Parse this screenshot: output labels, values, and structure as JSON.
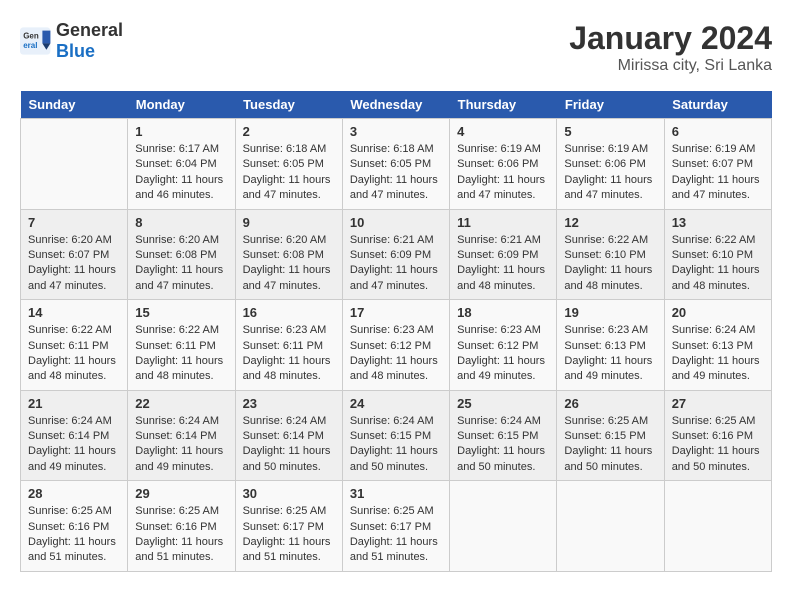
{
  "logo": {
    "general": "General",
    "blue": "Blue"
  },
  "title": "January 2024",
  "subtitle": "Mirissa city, Sri Lanka",
  "days_header": [
    "Sunday",
    "Monday",
    "Tuesday",
    "Wednesday",
    "Thursday",
    "Friday",
    "Saturday"
  ],
  "weeks": [
    [
      {
        "day": "",
        "info": ""
      },
      {
        "day": "1",
        "info": "Sunrise: 6:17 AM\nSunset: 6:04 PM\nDaylight: 11 hours\nand 46 minutes."
      },
      {
        "day": "2",
        "info": "Sunrise: 6:18 AM\nSunset: 6:05 PM\nDaylight: 11 hours\nand 47 minutes."
      },
      {
        "day": "3",
        "info": "Sunrise: 6:18 AM\nSunset: 6:05 PM\nDaylight: 11 hours\nand 47 minutes."
      },
      {
        "day": "4",
        "info": "Sunrise: 6:19 AM\nSunset: 6:06 PM\nDaylight: 11 hours\nand 47 minutes."
      },
      {
        "day": "5",
        "info": "Sunrise: 6:19 AM\nSunset: 6:06 PM\nDaylight: 11 hours\nand 47 minutes."
      },
      {
        "day": "6",
        "info": "Sunrise: 6:19 AM\nSunset: 6:07 PM\nDaylight: 11 hours\nand 47 minutes."
      }
    ],
    [
      {
        "day": "7",
        "info": "Sunrise: 6:20 AM\nSunset: 6:07 PM\nDaylight: 11 hours\nand 47 minutes."
      },
      {
        "day": "8",
        "info": "Sunrise: 6:20 AM\nSunset: 6:08 PM\nDaylight: 11 hours\nand 47 minutes."
      },
      {
        "day": "9",
        "info": "Sunrise: 6:20 AM\nSunset: 6:08 PM\nDaylight: 11 hours\nand 47 minutes."
      },
      {
        "day": "10",
        "info": "Sunrise: 6:21 AM\nSunset: 6:09 PM\nDaylight: 11 hours\nand 47 minutes."
      },
      {
        "day": "11",
        "info": "Sunrise: 6:21 AM\nSunset: 6:09 PM\nDaylight: 11 hours\nand 48 minutes."
      },
      {
        "day": "12",
        "info": "Sunrise: 6:22 AM\nSunset: 6:10 PM\nDaylight: 11 hours\nand 48 minutes."
      },
      {
        "day": "13",
        "info": "Sunrise: 6:22 AM\nSunset: 6:10 PM\nDaylight: 11 hours\nand 48 minutes."
      }
    ],
    [
      {
        "day": "14",
        "info": "Sunrise: 6:22 AM\nSunset: 6:11 PM\nDaylight: 11 hours\nand 48 minutes."
      },
      {
        "day": "15",
        "info": "Sunrise: 6:22 AM\nSunset: 6:11 PM\nDaylight: 11 hours\nand 48 minutes."
      },
      {
        "day": "16",
        "info": "Sunrise: 6:23 AM\nSunset: 6:11 PM\nDaylight: 11 hours\nand 48 minutes."
      },
      {
        "day": "17",
        "info": "Sunrise: 6:23 AM\nSunset: 6:12 PM\nDaylight: 11 hours\nand 48 minutes."
      },
      {
        "day": "18",
        "info": "Sunrise: 6:23 AM\nSunset: 6:12 PM\nDaylight: 11 hours\nand 49 minutes."
      },
      {
        "day": "19",
        "info": "Sunrise: 6:23 AM\nSunset: 6:13 PM\nDaylight: 11 hours\nand 49 minutes."
      },
      {
        "day": "20",
        "info": "Sunrise: 6:24 AM\nSunset: 6:13 PM\nDaylight: 11 hours\nand 49 minutes."
      }
    ],
    [
      {
        "day": "21",
        "info": "Sunrise: 6:24 AM\nSunset: 6:14 PM\nDaylight: 11 hours\nand 49 minutes."
      },
      {
        "day": "22",
        "info": "Sunrise: 6:24 AM\nSunset: 6:14 PM\nDaylight: 11 hours\nand 49 minutes."
      },
      {
        "day": "23",
        "info": "Sunrise: 6:24 AM\nSunset: 6:14 PM\nDaylight: 11 hours\nand 50 minutes."
      },
      {
        "day": "24",
        "info": "Sunrise: 6:24 AM\nSunset: 6:15 PM\nDaylight: 11 hours\nand 50 minutes."
      },
      {
        "day": "25",
        "info": "Sunrise: 6:24 AM\nSunset: 6:15 PM\nDaylight: 11 hours\nand 50 minutes."
      },
      {
        "day": "26",
        "info": "Sunrise: 6:25 AM\nSunset: 6:15 PM\nDaylight: 11 hours\nand 50 minutes."
      },
      {
        "day": "27",
        "info": "Sunrise: 6:25 AM\nSunset: 6:16 PM\nDaylight: 11 hours\nand 50 minutes."
      }
    ],
    [
      {
        "day": "28",
        "info": "Sunrise: 6:25 AM\nSunset: 6:16 PM\nDaylight: 11 hours\nand 51 minutes."
      },
      {
        "day": "29",
        "info": "Sunrise: 6:25 AM\nSunset: 6:16 PM\nDaylight: 11 hours\nand 51 minutes."
      },
      {
        "day": "30",
        "info": "Sunrise: 6:25 AM\nSunset: 6:17 PM\nDaylight: 11 hours\nand 51 minutes."
      },
      {
        "day": "31",
        "info": "Sunrise: 6:25 AM\nSunset: 6:17 PM\nDaylight: 11 hours\nand 51 minutes."
      },
      {
        "day": "",
        "info": ""
      },
      {
        "day": "",
        "info": ""
      },
      {
        "day": "",
        "info": ""
      }
    ]
  ]
}
